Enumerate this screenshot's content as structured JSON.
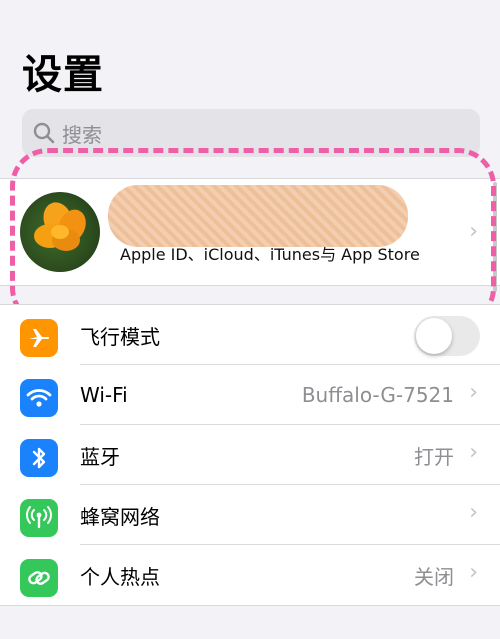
{
  "header": {
    "title": "设置"
  },
  "search": {
    "placeholder": "搜索"
  },
  "profile": {
    "subtitle": "Apple ID、iCloud、iTunes与 App Store"
  },
  "settings": {
    "airplane": {
      "label": "飞行模式",
      "enabled": false,
      "icon": "airplane-icon",
      "color": "#ff9500"
    },
    "wifi": {
      "label": "Wi-Fi",
      "value": "Buffalo-G-7521",
      "icon": "wifi-icon",
      "color": "#1a82fb"
    },
    "bluetooth": {
      "label": "蓝牙",
      "value": "打开",
      "icon": "bluetooth-icon",
      "color": "#1a82fb"
    },
    "cellular": {
      "label": "蜂窝网络",
      "icon": "cellular-antenna-icon",
      "color": "#34c759"
    },
    "hotspot": {
      "label": "个人热点",
      "value": "关闭",
      "icon": "hotspot-link-icon",
      "color": "#34c759"
    }
  },
  "colors": {
    "annotation": "#ee5fa7",
    "background": "#f2f2f7"
  }
}
